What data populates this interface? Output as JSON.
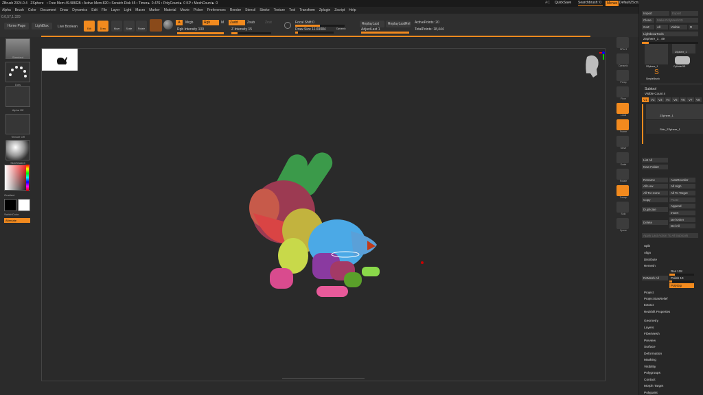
{
  "titlebar": {
    "app": "ZBrush 2024.0.4",
    "doc": "ZSphere",
    "stats": "• Free Mem 49.986GB • Active Mem 820 • Scratch Disk 45 • Timer► 0.476 • PolyCount► 0 KP • MeshCount► 0",
    "ac": "AC",
    "quicksave": "QuickSave",
    "searchbrush": "Searchbrush: 0",
    "menus": "Menus",
    "defaultscript": "DefaultZScript"
  },
  "coords": "0.0,57,1.329",
  "menubar": [
    "Alpha",
    "Brush",
    "Color",
    "Document",
    "Draw",
    "Dynamics",
    "Edit",
    "File",
    "Layer",
    "Light",
    "Macro",
    "Marker",
    "Material",
    "Movie",
    "Picker",
    "Preferences",
    "Render",
    "Stencil",
    "Stroke",
    "Texture",
    "Tool",
    "Transform",
    "Zplugin",
    "Zscript",
    "Help"
  ],
  "toolbar": {
    "home": "Home Page",
    "lightbox": "LightBox",
    "livebool": "Live Boolean",
    "edit": "Edit",
    "draw": "Draw",
    "move": "Move",
    "scale": "Scale",
    "rotate": "Rotate",
    "a": "A",
    "mrgb": "Mrgb",
    "rgb": "Rgb",
    "m": "M",
    "zadd": "Zadd",
    "zsub": "Zsub",
    "zcut": "Zcut",
    "rgb_int": "Rgb Intensity 100",
    "z_int": "Z Intensity 15",
    "focal": "Focal Shift 0",
    "drawsize": "Draw Size 11.69084",
    "dynamic": "Dynamic",
    "replaylast": "ReplayLast",
    "replaylastrel": "ReplayLastRel",
    "adjustlast": "AdjustLast 1",
    "activepoints": "ActivePoints: 20",
    "totalpoints": "TotalPoints: 18,444"
  },
  "leftshelf": {
    "standard": "Standard",
    "dots": "Dots",
    "alpha": "Alpha Off",
    "texture": "Texture Off",
    "material": "SkinShade4",
    "gradient": "Gradient",
    "switchcolor": "SwitchColor",
    "alternate": "Alternate"
  },
  "rightshelf": [
    "SPix 3",
    "Dynamic",
    "Persp",
    "Floor",
    "Local",
    "Frame",
    "Move",
    "Scale",
    "Rotate",
    "Transp",
    "Solo",
    "Xpose"
  ],
  "tray": {
    "import": "Import",
    "export": "Export",
    "clone": "Clone",
    "make_polymesh": "Make PolyMesh3D",
    "goz": "GoZ",
    "all": "All",
    "visible": "Visible",
    "r": "R",
    "lightbox_tools": "Lightbox▸Tools",
    "zsphere_value": "ZSphere_1 . 49",
    "tool1": "ZSphere_1",
    "tool2": "ZSphere_1",
    "tool3": "Cylinder3D",
    "tool4": "SimpleBrush",
    "subtool": "Subtool",
    "visible_count": "Visible Count 4",
    "versions": [
      "V1",
      "V2",
      "V3",
      "V4",
      "V5",
      "V6",
      "V7",
      "V8"
    ],
    "st1": "ZSphere_1",
    "st2": "Skin_ZSphere_1",
    "listall": "List All",
    "newfolder": "New Folder",
    "rename": "Rename",
    "autoreorder": "AutoReorder",
    "alllow": "All Low",
    "allhigh": "All High",
    "alltohome": "All To Home",
    "alltotarget": "All To Target",
    "copy": "Copy",
    "paste": "Paste",
    "duplicate": "Duplicate",
    "append": "Append",
    "insert": "Insert",
    "delete": "Delete",
    "delother": "Del Other",
    "delall": "Del All",
    "applylast": "Apply Last Action To All Subtools",
    "split": "Split",
    "align": "Align",
    "distribute": "Distribute",
    "remesh": "Remesh",
    "remeshall": "ReMesh All",
    "res": "Res 128",
    "polish": "Polish 10",
    "polygrp": "PolyGrp",
    "project": "Project",
    "projectbasrelief": "Project BasRelief",
    "extract": "Extract",
    "redshift": "Redshift Properties",
    "menus": [
      "Geometry",
      "Layers",
      "FiberMesh",
      "Preview",
      "Surface",
      "Deformation",
      "Masking",
      "Visibility",
      "Polygroups",
      "Contact",
      "Morph Target",
      "Polypaint"
    ]
  },
  "colors": {
    "accent": "#f28a1e",
    "bg": "#2a2a2a"
  }
}
